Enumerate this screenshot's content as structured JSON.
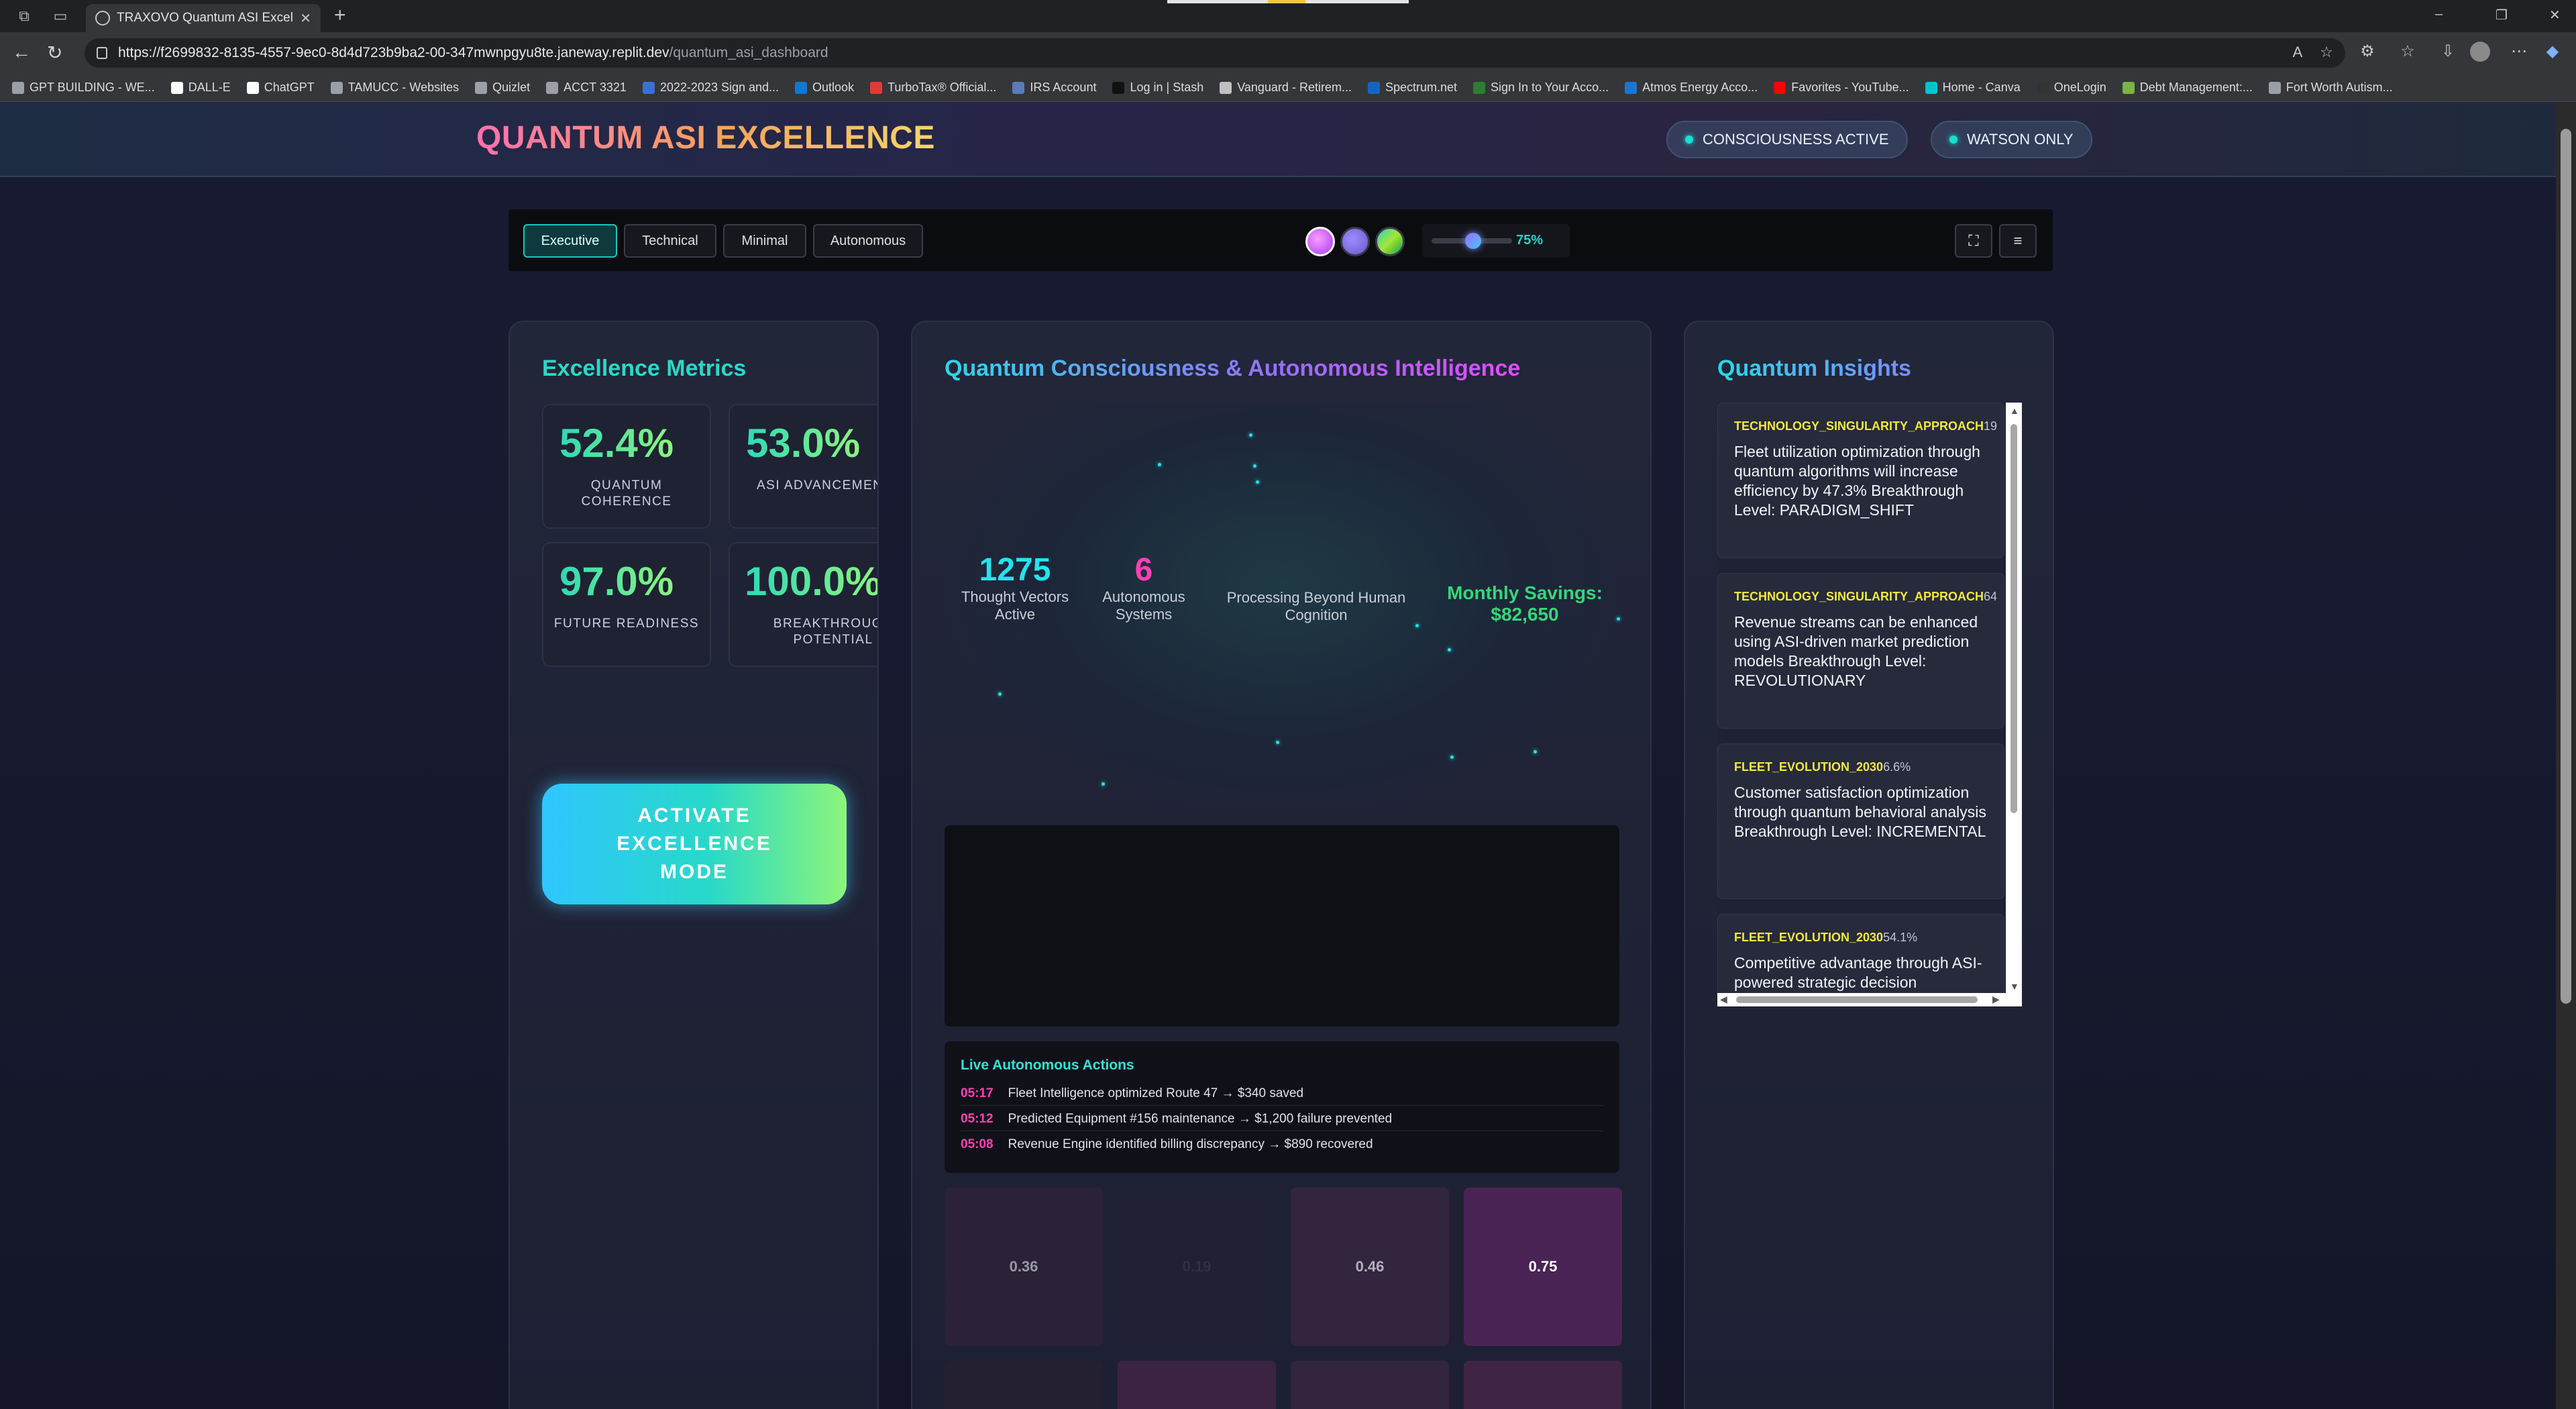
{
  "browser": {
    "tab_title": "TRAXOVO Quantum ASI Excellen",
    "url_main": "https://f2699832-8135-4557-9ec0-8d4d723b9ba2-00-347mwnpgyu8te.janeway.replit.dev",
    "url_path": "/quantum_asi_dashboard",
    "bookmarks": [
      {
        "label": "GPT BUILDING - WE...",
        "color": "#9aa0a6"
      },
      {
        "label": "DALL-E",
        "color": "#ffffff"
      },
      {
        "label": "ChatGPT",
        "color": "#ffffff"
      },
      {
        "label": "TAMUCC - Websites",
        "color": "#9aa0a6"
      },
      {
        "label": "Quizlet",
        "color": "#9aa0a6"
      },
      {
        "label": "ACCT 3321",
        "color": "#9aa0a6"
      },
      {
        "label": "2022-2023 Sign and...",
        "color": "#3b6fd8"
      },
      {
        "label": "Outlook",
        "color": "#0f78d4"
      },
      {
        "label": "TurboTax® Official...",
        "color": "#e53935"
      },
      {
        "label": "IRS Account",
        "color": "#5a7bb5"
      },
      {
        "label": "Log in | Stash",
        "color": "#111111"
      },
      {
        "label": "Vanguard - Retirem...",
        "color": "#c0c0c0"
      },
      {
        "label": "Spectrum.net",
        "color": "#1565c0"
      },
      {
        "label": "Sign In to Your Acco...",
        "color": "#2e7d32"
      },
      {
        "label": "Atmos Energy Acco...",
        "color": "#1976d2"
      },
      {
        "label": "Favorites - YouTube...",
        "color": "#ff0000"
      },
      {
        "label": "Home - Canva",
        "color": "#00c4cc"
      },
      {
        "label": "OneLogin",
        "color": "#333333"
      },
      {
        "label": "Debt Management:...",
        "color": "#7cb342"
      },
      {
        "label": "Fort Worth Autism...",
        "color": "#9aa0a6"
      }
    ]
  },
  "header": {
    "brand": "QUANTUM ASI EXCELLENCE",
    "pill_1": "CONSCIOUSNESS ACTIVE",
    "pill_2": "WATSON ONLY"
  },
  "toolbar": {
    "modes": [
      "Executive",
      "Technical",
      "Minimal",
      "Autonomous"
    ],
    "active_mode": "Executive",
    "intensity_label": "75%",
    "intensity_value": 0.75
  },
  "metrics": {
    "title": "Excellence Metrics",
    "items": [
      {
        "value": "52.4%",
        "label": "QUANTUM COHERENCE"
      },
      {
        "value": "53.0%",
        "label": "ASI ADVANCEMENT"
      },
      {
        "value": "97.0%",
        "label": "FUTURE READINESS"
      },
      {
        "value": "100.0%",
        "label": "BREAKTHROUGH POTENTIAL"
      }
    ],
    "activate_label": "ACTIVATE EXCELLENCE MODE"
  },
  "consciousness": {
    "title": "Quantum Consciousness & Autonomous Intelligence",
    "thought_vectors": "1275",
    "thought_vectors_caption": "Thought Vectors Active",
    "autonomous_systems": "6",
    "autonomous_systems_caption": "Autonomous Systems",
    "processing_caption": "Processing Beyond Human Cognition",
    "savings_label": "Monthly Savings:",
    "savings_value": "$82,650",
    "actions_title": "Live Autonomous Actions",
    "actions": [
      {
        "time": "05:17",
        "text": "Fleet Intelligence optimized Route 47 → $340 saved"
      },
      {
        "time": "05:12",
        "text": "Predicted Equipment #156 maintenance → $1,200 failure prevented"
      },
      {
        "time": "05:08",
        "text": "Revenue Engine identified billing discrepancy → $890 recovered"
      }
    ],
    "grid_values": [
      "0.36",
      "0.19",
      "0.46",
      "0.75"
    ]
  },
  "insights": {
    "title": "Quantum Insights",
    "cards": [
      {
        "category": "TECHNOLOGY_SINGULARITY_APPROACH",
        "pct": "19",
        "text": "Fleet utilization optimization through quantum algorithms will increase efficiency by 47.3% Breakthrough Level: PARADIGM_SHIFT"
      },
      {
        "category": "TECHNOLOGY_SINGULARITY_APPROACH",
        "pct": "64",
        "text": "Revenue streams can be enhanced using ASI-driven market prediction models Breakthrough Level: REVOLUTIONARY"
      },
      {
        "category": "FLEET_EVOLUTION_2030",
        "pct": "6.6%",
        "text": "Customer satisfaction optimization through quantum behavioral analysis Breakthrough Level: INCREMENTAL"
      },
      {
        "category": "FLEET_EVOLUTION_2030",
        "pct": "54.1%",
        "text": "Competitive advantage through ASI-powered strategic decision"
      }
    ]
  }
}
